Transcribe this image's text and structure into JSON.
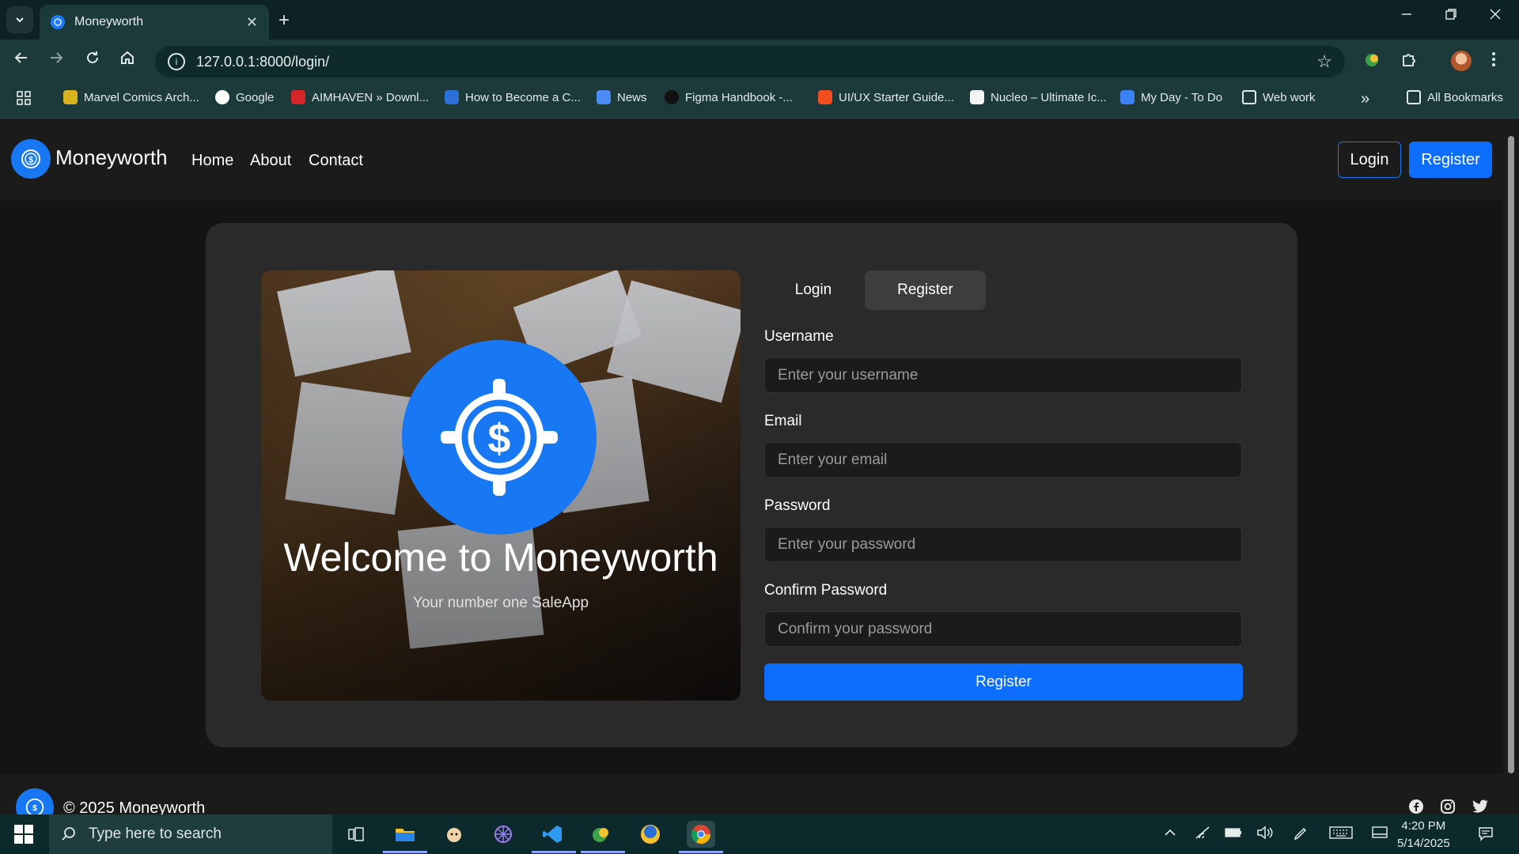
{
  "browser": {
    "tab_title": "Moneyworth",
    "tab_close": "✕",
    "new_tab": "+",
    "url": "127.0.0.1:8000/login/",
    "bookmarks": [
      {
        "label": "Marvel Comics Arch..."
      },
      {
        "label": "Google"
      },
      {
        "label": "AIMHAVEN » Downl..."
      },
      {
        "label": "How to Become a C..."
      },
      {
        "label": "News"
      },
      {
        "label": "Figma Handbook -..."
      },
      {
        "label": "UI/UX Starter Guide..."
      },
      {
        "label": "Nucleo – Ultimate Ic..."
      },
      {
        "label": "My Day - To Do"
      },
      {
        "label": "Web work"
      }
    ],
    "more_bookmarks": "»",
    "all_bookmarks": "All Bookmarks"
  },
  "site": {
    "brand": "Moneyworth",
    "nav": {
      "home": "Home",
      "about": "About",
      "contact": "Contact"
    },
    "login_button": "Login",
    "register_button": "Register",
    "accent": "#1877f2",
    "primary_button_color": "#0d6efd"
  },
  "hero": {
    "title": "Welcome to Moneyworth",
    "subtitle": "Your number one SaleApp"
  },
  "form": {
    "tab_login": "Login",
    "tab_register": "Register",
    "active_tab": "Register",
    "username_label": "Username",
    "username_placeholder": "Enter your username",
    "email_label": "Email",
    "email_placeholder": "Enter your email",
    "password_label": "Password",
    "password_placeholder": "Enter your password",
    "confirm_label": "Confirm Password",
    "confirm_placeholder": "Confirm your password",
    "submit": "Register"
  },
  "footer": {
    "copyright": "© 2025 Moneyworth",
    "social": [
      "facebook-icon",
      "instagram-icon",
      "twitter-icon"
    ]
  },
  "taskbar": {
    "search_placeholder": "Type here to search",
    "time": "4:20 PM",
    "date": "5/14/2025"
  }
}
